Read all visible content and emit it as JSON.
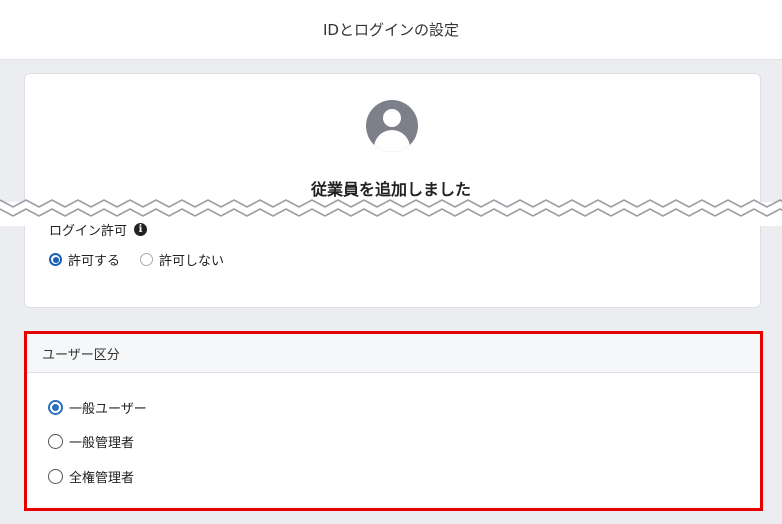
{
  "header": {
    "title": "IDとログインの設定"
  },
  "profile": {
    "avatar_icon": "user-avatar-icon",
    "message": "従業員を追加しました"
  },
  "login_permission": {
    "label": "ログイン許可",
    "info_icon": "info-icon",
    "info_glyph": "i",
    "options": [
      {
        "label": "許可する",
        "selected": true
      },
      {
        "label": "許可しない",
        "selected": false
      }
    ]
  },
  "user_type": {
    "title": "ユーザー区分",
    "options": [
      {
        "label": "一般ユーザー",
        "selected": true
      },
      {
        "label": "一般管理者",
        "selected": false
      },
      {
        "label": "全権管理者",
        "selected": false
      }
    ]
  },
  "colors": {
    "highlight": "#e60000",
    "radio_selected": "#1a5fb4",
    "page_background": "#ebedf1"
  }
}
